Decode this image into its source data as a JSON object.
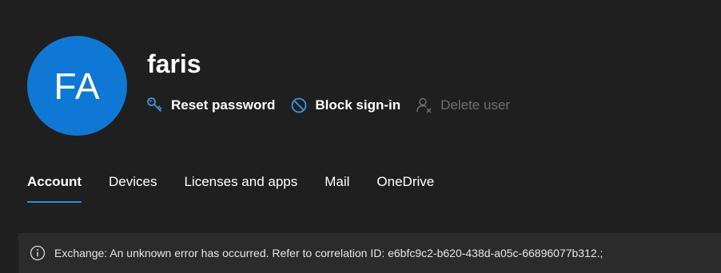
{
  "user": {
    "initials": "FA",
    "name": "faris"
  },
  "actions": {
    "reset_password": "Reset password",
    "block_signin": "Block sign-in",
    "delete_user": "Delete user"
  },
  "tabs": [
    {
      "label": "Account",
      "active": true
    },
    {
      "label": "Devices",
      "active": false
    },
    {
      "label": "Licenses and apps",
      "active": false
    },
    {
      "label": "Mail",
      "active": false
    },
    {
      "label": "OneDrive",
      "active": false
    }
  ],
  "alert": {
    "message": "Exchange: An unknown error has occurred. Refer to correlation ID: e6bfc9c2-b620-438d-a05c-66896077b312.;"
  },
  "colors": {
    "background": "#1f1f1f",
    "avatar": "#0f78d4",
    "accent": "#2a8de0",
    "disabled": "#6f6f6f",
    "alert_background": "#2b2b2b"
  },
  "icons": {
    "reset_password": "key-icon",
    "block_signin": "block-icon",
    "delete_user": "delete-user-icon",
    "alert": "info-icon"
  }
}
